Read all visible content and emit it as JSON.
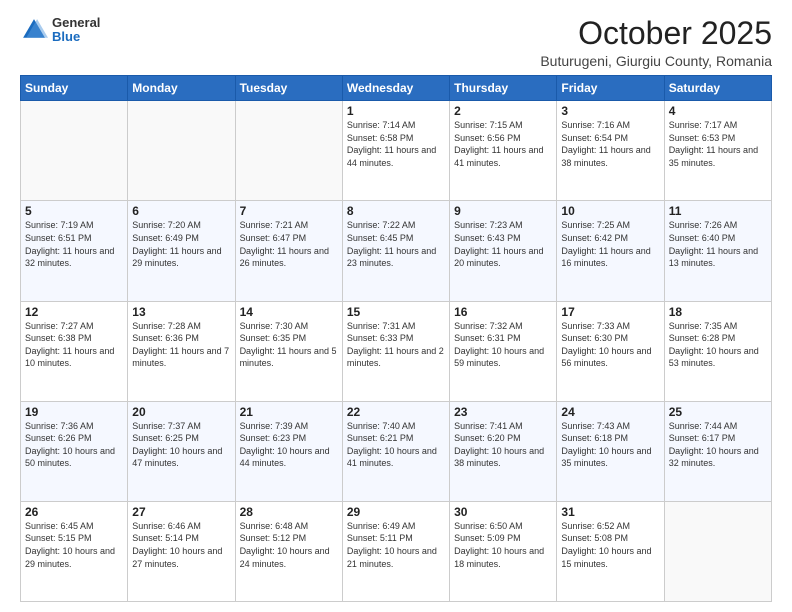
{
  "header": {
    "logo_general": "General",
    "logo_blue": "Blue",
    "title": "October 2025",
    "subtitle": "Buturugeni, Giurgiu County, Romania"
  },
  "days_of_week": [
    "Sunday",
    "Monday",
    "Tuesday",
    "Wednesday",
    "Thursday",
    "Friday",
    "Saturday"
  ],
  "weeks": [
    [
      {
        "day": "",
        "info": ""
      },
      {
        "day": "",
        "info": ""
      },
      {
        "day": "",
        "info": ""
      },
      {
        "day": "1",
        "info": "Sunrise: 7:14 AM\nSunset: 6:58 PM\nDaylight: 11 hours and 44 minutes."
      },
      {
        "day": "2",
        "info": "Sunrise: 7:15 AM\nSunset: 6:56 PM\nDaylight: 11 hours and 41 minutes."
      },
      {
        "day": "3",
        "info": "Sunrise: 7:16 AM\nSunset: 6:54 PM\nDaylight: 11 hours and 38 minutes."
      },
      {
        "day": "4",
        "info": "Sunrise: 7:17 AM\nSunset: 6:53 PM\nDaylight: 11 hours and 35 minutes."
      }
    ],
    [
      {
        "day": "5",
        "info": "Sunrise: 7:19 AM\nSunset: 6:51 PM\nDaylight: 11 hours and 32 minutes."
      },
      {
        "day": "6",
        "info": "Sunrise: 7:20 AM\nSunset: 6:49 PM\nDaylight: 11 hours and 29 minutes."
      },
      {
        "day": "7",
        "info": "Sunrise: 7:21 AM\nSunset: 6:47 PM\nDaylight: 11 hours and 26 minutes."
      },
      {
        "day": "8",
        "info": "Sunrise: 7:22 AM\nSunset: 6:45 PM\nDaylight: 11 hours and 23 minutes."
      },
      {
        "day": "9",
        "info": "Sunrise: 7:23 AM\nSunset: 6:43 PM\nDaylight: 11 hours and 20 minutes."
      },
      {
        "day": "10",
        "info": "Sunrise: 7:25 AM\nSunset: 6:42 PM\nDaylight: 11 hours and 16 minutes."
      },
      {
        "day": "11",
        "info": "Sunrise: 7:26 AM\nSunset: 6:40 PM\nDaylight: 11 hours and 13 minutes."
      }
    ],
    [
      {
        "day": "12",
        "info": "Sunrise: 7:27 AM\nSunset: 6:38 PM\nDaylight: 11 hours and 10 minutes."
      },
      {
        "day": "13",
        "info": "Sunrise: 7:28 AM\nSunset: 6:36 PM\nDaylight: 11 hours and 7 minutes."
      },
      {
        "day": "14",
        "info": "Sunrise: 7:30 AM\nSunset: 6:35 PM\nDaylight: 11 hours and 5 minutes."
      },
      {
        "day": "15",
        "info": "Sunrise: 7:31 AM\nSunset: 6:33 PM\nDaylight: 11 hours and 2 minutes."
      },
      {
        "day": "16",
        "info": "Sunrise: 7:32 AM\nSunset: 6:31 PM\nDaylight: 10 hours and 59 minutes."
      },
      {
        "day": "17",
        "info": "Sunrise: 7:33 AM\nSunset: 6:30 PM\nDaylight: 10 hours and 56 minutes."
      },
      {
        "day": "18",
        "info": "Sunrise: 7:35 AM\nSunset: 6:28 PM\nDaylight: 10 hours and 53 minutes."
      }
    ],
    [
      {
        "day": "19",
        "info": "Sunrise: 7:36 AM\nSunset: 6:26 PM\nDaylight: 10 hours and 50 minutes."
      },
      {
        "day": "20",
        "info": "Sunrise: 7:37 AM\nSunset: 6:25 PM\nDaylight: 10 hours and 47 minutes."
      },
      {
        "day": "21",
        "info": "Sunrise: 7:39 AM\nSunset: 6:23 PM\nDaylight: 10 hours and 44 minutes."
      },
      {
        "day": "22",
        "info": "Sunrise: 7:40 AM\nSunset: 6:21 PM\nDaylight: 10 hours and 41 minutes."
      },
      {
        "day": "23",
        "info": "Sunrise: 7:41 AM\nSunset: 6:20 PM\nDaylight: 10 hours and 38 minutes."
      },
      {
        "day": "24",
        "info": "Sunrise: 7:43 AM\nSunset: 6:18 PM\nDaylight: 10 hours and 35 minutes."
      },
      {
        "day": "25",
        "info": "Sunrise: 7:44 AM\nSunset: 6:17 PM\nDaylight: 10 hours and 32 minutes."
      }
    ],
    [
      {
        "day": "26",
        "info": "Sunrise: 6:45 AM\nSunset: 5:15 PM\nDaylight: 10 hours and 29 minutes."
      },
      {
        "day": "27",
        "info": "Sunrise: 6:46 AM\nSunset: 5:14 PM\nDaylight: 10 hours and 27 minutes."
      },
      {
        "day": "28",
        "info": "Sunrise: 6:48 AM\nSunset: 5:12 PM\nDaylight: 10 hours and 24 minutes."
      },
      {
        "day": "29",
        "info": "Sunrise: 6:49 AM\nSunset: 5:11 PM\nDaylight: 10 hours and 21 minutes."
      },
      {
        "day": "30",
        "info": "Sunrise: 6:50 AM\nSunset: 5:09 PM\nDaylight: 10 hours and 18 minutes."
      },
      {
        "day": "31",
        "info": "Sunrise: 6:52 AM\nSunset: 5:08 PM\nDaylight: 10 hours and 15 minutes."
      },
      {
        "day": "",
        "info": ""
      }
    ]
  ]
}
